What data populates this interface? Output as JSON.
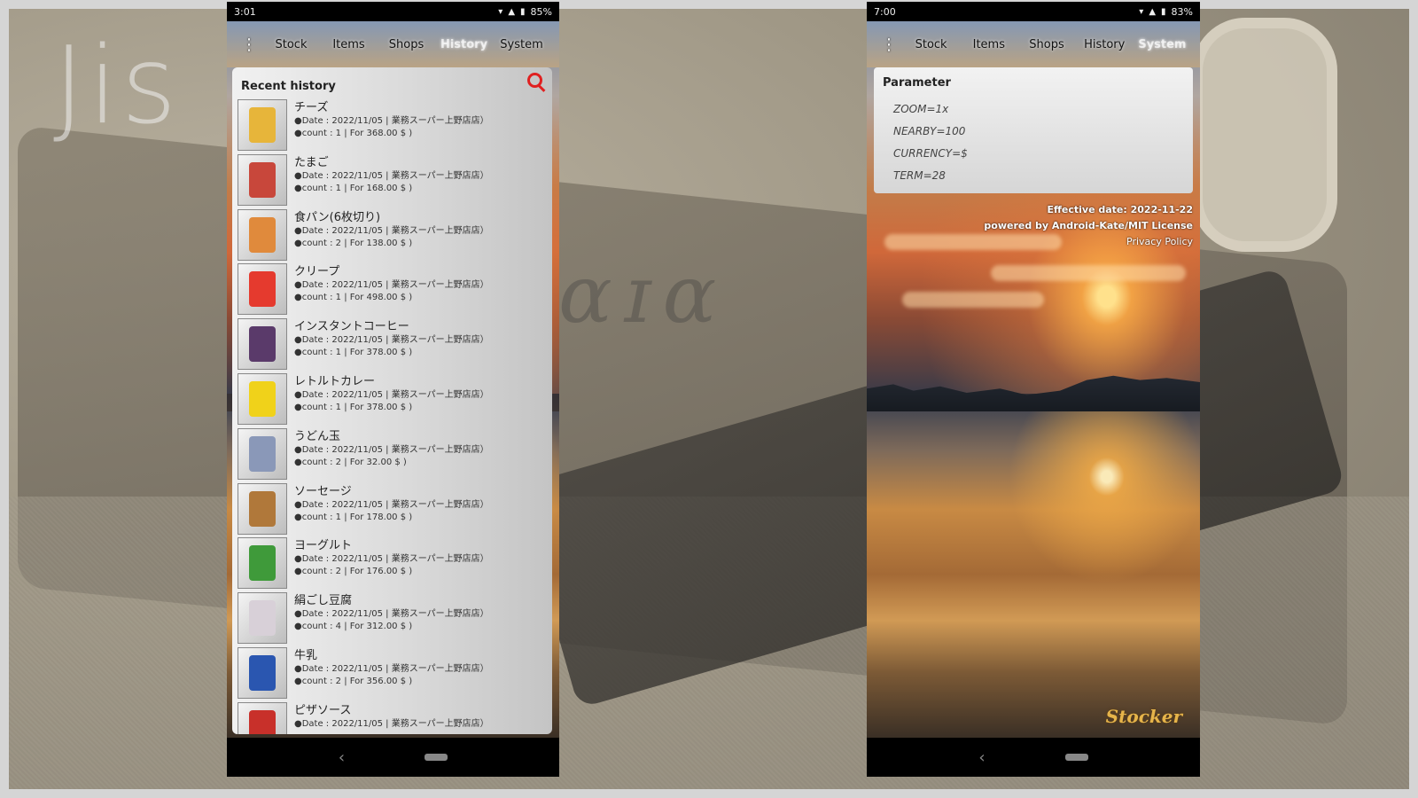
{
  "watermark": "Jis",
  "bg_logo": "ɑɪɑ",
  "left_phone": {
    "status": {
      "time": "3:01",
      "battery": "85%"
    },
    "menu": "⋮",
    "tabs": [
      "Stock",
      "Items",
      "Shops",
      "History",
      "System"
    ],
    "active_tab": "History",
    "panel_title": "Recent history",
    "items": [
      {
        "name": "チーズ",
        "date": "●Date : 2022/11/05 | 業務スーパー上野店店）",
        "count": "●count : 1 | For 368.00 $ )",
        "color": "#e7b53a"
      },
      {
        "name": "たまご",
        "date": "●Date : 2022/11/05 | 業務スーパー上野店店）",
        "count": "●count : 1 | For 168.00 $ )",
        "color": "#c8473b"
      },
      {
        "name": "食パン(6枚切り)",
        "date": "●Date : 2022/11/05 | 業務スーパー上野店店）",
        "count": "●count : 2 | For 138.00 $ )",
        "color": "#e08a3c"
      },
      {
        "name": "クリープ",
        "date": "●Date : 2022/11/05 | 業務スーパー上野店店）",
        "count": "●count : 1 | For 498.00 $ )",
        "color": "#e53a2e"
      },
      {
        "name": "インスタントコーヒー",
        "date": "●Date : 2022/11/05 | 業務スーパー上野店店）",
        "count": "●count : 1 | For 378.00 $ )",
        "color": "#5a3a6a"
      },
      {
        "name": "レトルトカレー",
        "date": "●Date : 2022/11/05 | 業務スーパー上野店店）",
        "count": "●count : 1 | For 378.00 $ )",
        "color": "#f0d21a"
      },
      {
        "name": "うどん玉",
        "date": "●Date : 2022/11/05 | 業務スーパー上野店店）",
        "count": "●count : 2 | For 32.00 $ )",
        "color": "#8a98b8"
      },
      {
        "name": "ソーセージ",
        "date": "●Date : 2022/11/05 | 業務スーパー上野店店）",
        "count": "●count : 1 | For 178.00 $ )",
        "color": "#b0783a"
      },
      {
        "name": "ヨーグルト",
        "date": "●Date : 2022/11/05 | 業務スーパー上野店店）",
        "count": "●count : 2 | For 176.00 $ )",
        "color": "#3f9a3a"
      },
      {
        "name": "絹ごし豆腐",
        "date": "●Date : 2022/11/05 | 業務スーパー上野店店）",
        "count": "●count : 4 | For 312.00 $ )",
        "color": "#d8d0d8"
      },
      {
        "name": "牛乳",
        "date": "●Date : 2022/11/05 | 業務スーパー上野店店）",
        "count": "●count : 2 | For 356.00 $ )",
        "color": "#2a56b0"
      },
      {
        "name": "ピザソース",
        "date": "●Date : 2022/11/05 | 業務スーパー上野店店）",
        "count": "",
        "color": "#c8302a"
      }
    ]
  },
  "right_phone": {
    "status": {
      "time": "7:00",
      "battery": "83%"
    },
    "menu": "⋮",
    "tabs": [
      "Stock",
      "Items",
      "Shops",
      "History",
      "System"
    ],
    "active_tab": "System",
    "param_title": "Parameter",
    "params": [
      "ZOOM=1x",
      "NEARBY=100",
      "CURRENCY=$",
      "TERM=28"
    ],
    "effective": "Effective date: 2022-11-22",
    "powered": "powered by Android-Kate/MIT License",
    "privacy": "Privacy Policy",
    "sticker": "Stocker"
  },
  "nav": {
    "back": "‹"
  }
}
